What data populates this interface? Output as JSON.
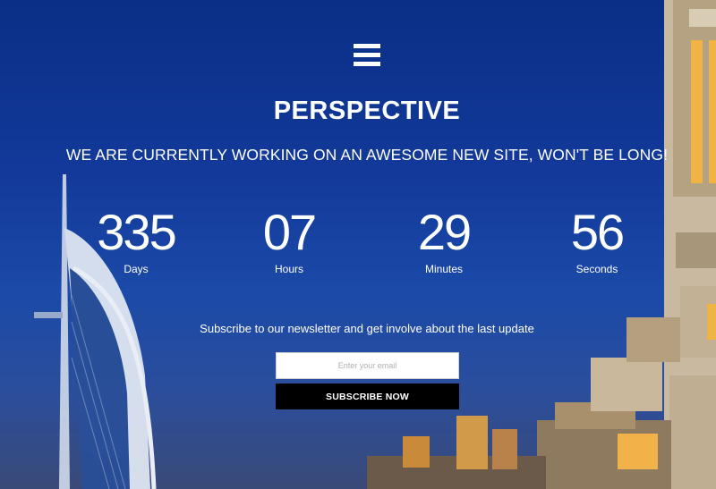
{
  "brand": {
    "title": "PERSPECTIVE",
    "tagline": "WE ARE CURRENTLY WORKING ON AN AWESOME NEW SITE, WON'T BE LONG!"
  },
  "countdown": [
    {
      "value": "335",
      "label": "Days"
    },
    {
      "value": "07",
      "label": "Hours"
    },
    {
      "value": "29",
      "label": "Minutes"
    },
    {
      "value": "56",
      "label": "Seconds"
    }
  ],
  "newsletter": {
    "text": "Subscribe to our newsletter and get involve about the last update",
    "placeholder": "Enter your email",
    "button_label": "SUBSCRIBE NOW"
  },
  "icons": {
    "menu": "hamburger-menu-icon"
  },
  "colors": {
    "sky_top": "#0a2f86",
    "sky_bottom": "#3a4a78",
    "button_bg": "#000000",
    "text": "#ffffff"
  }
}
